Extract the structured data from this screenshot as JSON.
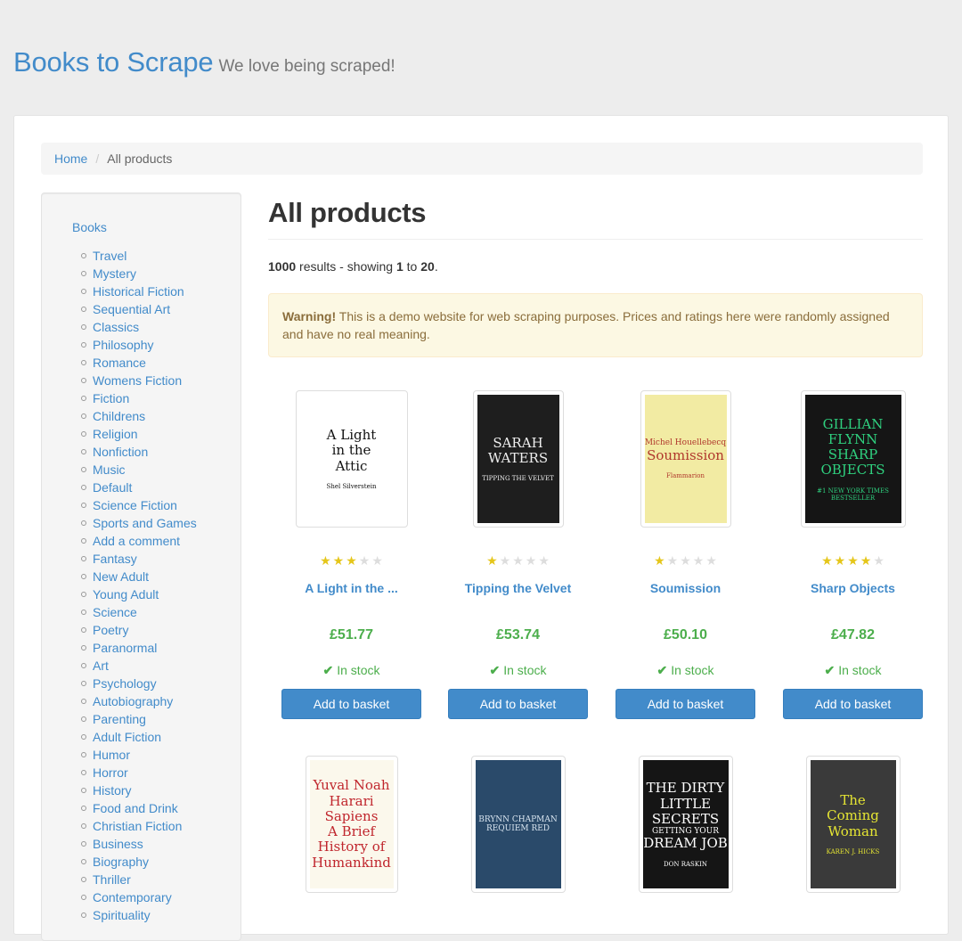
{
  "header": {
    "brand": "Books to Scrape",
    "tagline": "We love being scraped!"
  },
  "breadcrumb": {
    "home": "Home",
    "separator": "/",
    "current": "All products"
  },
  "sidebar": {
    "root": "Books",
    "categories": [
      "Travel",
      "Mystery",
      "Historical Fiction",
      "Sequential Art",
      "Classics",
      "Philosophy",
      "Romance",
      "Womens Fiction",
      "Fiction",
      "Childrens",
      "Religion",
      "Nonfiction",
      "Music",
      "Default",
      "Science Fiction",
      "Sports and Games",
      "Add a comment",
      "Fantasy",
      "New Adult",
      "Young Adult",
      "Science",
      "Poetry",
      "Paranormal",
      "Art",
      "Psychology",
      "Autobiography",
      "Parenting",
      "Adult Fiction",
      "Humor",
      "Horror",
      "History",
      "Food and Drink",
      "Christian Fiction",
      "Business",
      "Biography",
      "Thriller",
      "Contemporary",
      "Spirituality"
    ]
  },
  "main": {
    "heading": "All products",
    "results": {
      "total": "1000",
      "text1": " results - showing ",
      "from": "1",
      "text2": " to ",
      "to": "20",
      "end": "."
    },
    "alert": {
      "label": "Warning!",
      "text": " This is a demo website for web scraping purposes. Prices and ratings here were randomly assigned and have no real meaning."
    }
  },
  "products": [
    {
      "title": "A Light in the ...",
      "price": "£51.77",
      "rating": 3,
      "stock": "In stock",
      "button": "Add to basket",
      "cover": {
        "lines": [
          "A Light",
          "in the",
          "Attic"
        ],
        "footer": "Shel Silverstein",
        "bg": "#ffffff",
        "fg": "#111111"
      }
    },
    {
      "title": "Tipping the Velvet",
      "price": "£53.74",
      "rating": 1,
      "stock": "In stock",
      "button": "Add to basket",
      "cover": {
        "lines": [
          "SARAH",
          "WATERS"
        ],
        "footer": "TIPPING THE VELVET",
        "bg": "#1e1e1e",
        "fg": "#eeeeee"
      }
    },
    {
      "title": "Soumission",
      "price": "£50.10",
      "rating": 1,
      "stock": "In stock",
      "button": "Add to basket",
      "cover": {
        "lines": [
          "Michel Houellebecq",
          "Soumission"
        ],
        "footer": "Flammarion",
        "bg": "#f2eba3",
        "fg": "#b0372c"
      }
    },
    {
      "title": "Sharp Objects",
      "price": "£47.82",
      "rating": 4,
      "stock": "In stock",
      "button": "Add to basket",
      "cover": {
        "lines": [
          "GILLIAN",
          "FLYNN",
          "SHARP",
          "OBJECTS"
        ],
        "footer": "#1 NEW YORK TIMES BESTSELLER",
        "bg": "#151515",
        "fg": "#2fd17f"
      }
    },
    {
      "cover": {
        "lines": [
          "Yuval Noah",
          "Harari",
          "Sapiens",
          "A Brief",
          "History of",
          "Humankind"
        ],
        "footer": "",
        "bg": "#fbf8ec",
        "fg": "#c0262d"
      }
    },
    {
      "cover": {
        "lines": [
          "BRYNN CHAPMAN",
          "REQUIEM RED"
        ],
        "footer": "",
        "bg": "#2a4a6a",
        "fg": "#d8e4ef"
      }
    },
    {
      "cover": {
        "lines": [
          "THE DIRTY",
          "LITTLE",
          "SECRETS",
          "GETTING YOUR",
          "DREAM JOB"
        ],
        "footer": "DON RASKIN",
        "bg": "#151515",
        "fg": "#ffffff"
      }
    },
    {
      "cover": {
        "lines": [
          "The",
          "Coming",
          "Woman"
        ],
        "footer": "KAREN J. HICKS",
        "bg": "#3a3a3a",
        "fg": "#e5e533"
      }
    }
  ],
  "colors": {
    "link": "#428bca",
    "price": "#4cae4c",
    "star_on": "#e5c61a",
    "star_off": "#dddddd"
  }
}
